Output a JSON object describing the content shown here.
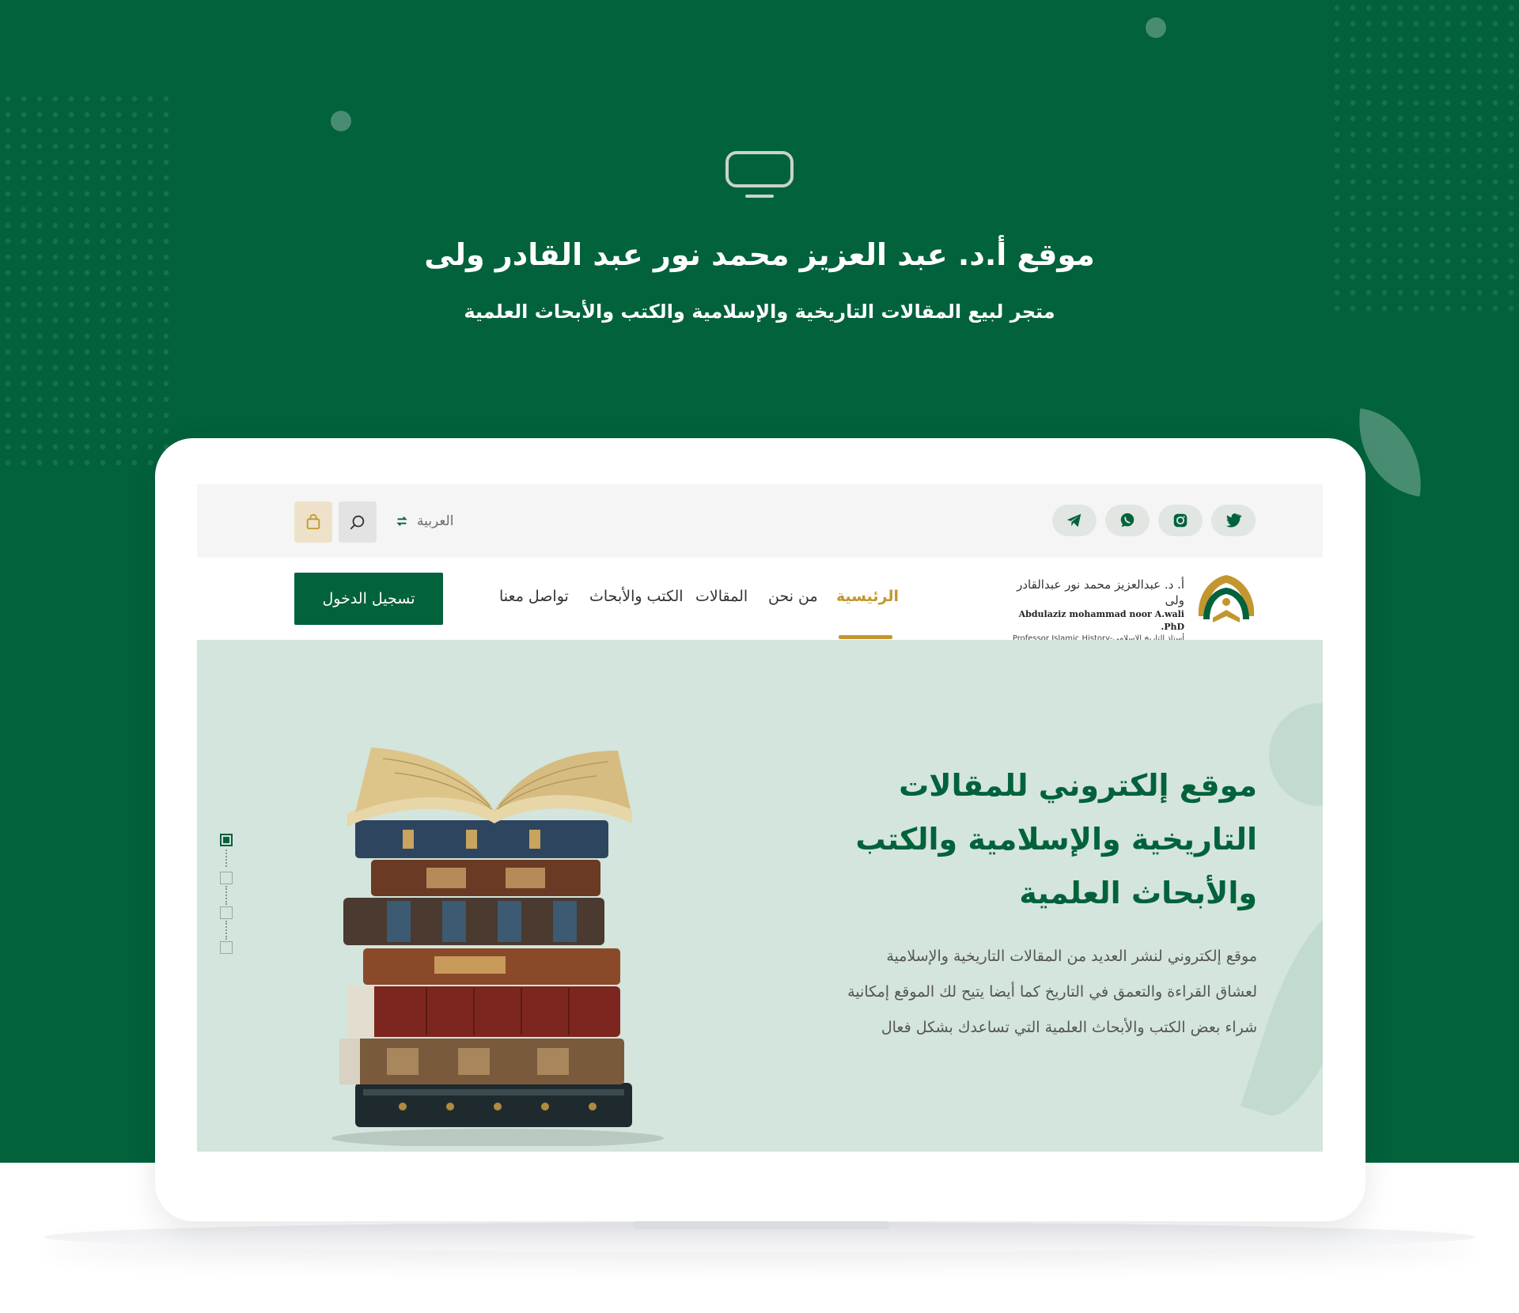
{
  "header": {
    "title": "موقع أ.د. عبد العزيز محمد نور عبد القادر ولى",
    "subtitle": "متجر لبيع المقالات التاريخية والإسلامية والكتب والأبحاث العلمية"
  },
  "topbar": {
    "language_label": "العربية",
    "social_icons": [
      "telegram-icon",
      "whatsapp-icon",
      "instagram-icon",
      "twitter-icon"
    ]
  },
  "nav": {
    "login_label": "تسجيل الدخول",
    "items": [
      "الرئيسية",
      "من نحن",
      "المقالات",
      "الكتب والأبحاث",
      "تواصل معنا"
    ],
    "active_item": "الرئيسية"
  },
  "logo": {
    "arabic_name": "أ. د. عبدالعزيز محمد نور عبدالقادر ولى",
    "english_name": "Abdulaziz mohammad noor A.wali .PhD",
    "role": "Professor Islamic History-أستاذ التاريخ الإسلامي"
  },
  "hero": {
    "heading_lines": [
      "موقع إلكتروني للمقالات",
      "التاريخية والإسلامية والكتب",
      "والأبحاث العلمية"
    ],
    "text_lines": [
      "موقع إلكتروني لنشر العديد من المقالات التاريخية والإسلامية",
      "لعشاق القراءة والتعمق في التاريخ كما أيضا يتيح لك الموقع إمكانية",
      "شراء بعض الكتب والأبحاث العلمية التي تساعدك بشكل فعال"
    ],
    "slide_count": 4,
    "active_slide": 1
  },
  "colors": {
    "brand_green": "#02623c",
    "accent_gold": "#c4962f",
    "hero_bg": "#d3e5dc"
  }
}
